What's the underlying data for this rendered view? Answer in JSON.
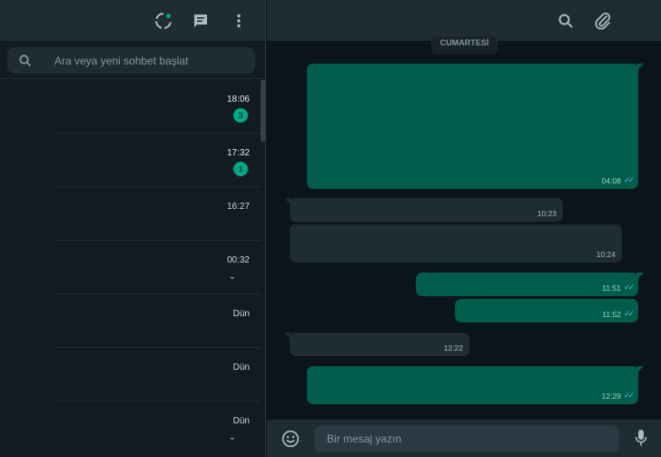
{
  "left_header": {
    "icons": [
      "status-icon",
      "new-chat-icon",
      "menu-icon"
    ]
  },
  "search": {
    "placeholder": "Ara veya yeni sohbet başlat"
  },
  "chats": [
    {
      "time": "18:06",
      "unread": "3",
      "extra": ""
    },
    {
      "time": "17:32",
      "unread": "1",
      "extra": ""
    },
    {
      "time": "16:27",
      "unread": "",
      "extra": ""
    },
    {
      "time": "00:32",
      "unread": "",
      "extra": "⌄"
    },
    {
      "time": "Dün",
      "unread": "",
      "extra": ""
    },
    {
      "time": "Dün",
      "unread": "",
      "extra": ""
    },
    {
      "time": "Dün",
      "unread": "",
      "extra": "⌄"
    }
  ],
  "conversation": {
    "header_icons": [
      "search-icon",
      "attach-icon"
    ],
    "date_chip": "CUMARTESİ",
    "messages": [
      {
        "dir": "out",
        "time": "04:08",
        "ticks": "✓✓"
      },
      {
        "dir": "in",
        "time": "10:23",
        "ticks": ""
      },
      {
        "dir": "in",
        "time": "10:24",
        "ticks": ""
      },
      {
        "dir": "out",
        "time": "11:51",
        "ticks": "✓✓"
      },
      {
        "dir": "out",
        "time": "11:52",
        "ticks": "✓✓"
      },
      {
        "dir": "in",
        "time": "12:22",
        "ticks": ""
      },
      {
        "dir": "out",
        "time": "12:29",
        "ticks": "✓✓"
      }
    ]
  },
  "composer": {
    "placeholder": "Bir mesaj yazın"
  },
  "colors": {
    "accent": "#00a884",
    "outgoing_bubble": "#005c4b",
    "incoming_bubble": "#202c33",
    "read_ticks": "#53bdeb"
  }
}
